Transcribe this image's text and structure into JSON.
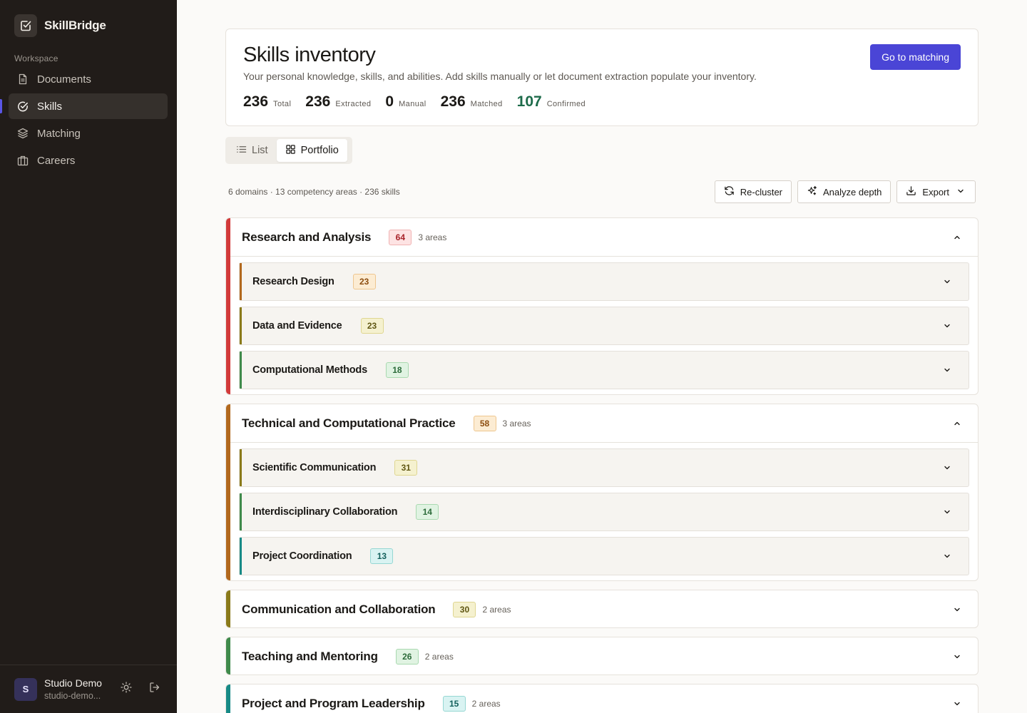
{
  "app": {
    "name": "SkillBridge"
  },
  "sidebar": {
    "section_label": "Workspace",
    "items": [
      {
        "label": "Documents",
        "icon": "document-icon",
        "active": false
      },
      {
        "label": "Skills",
        "icon": "check-circle-icon",
        "active": true
      },
      {
        "label": "Matching",
        "icon": "layers-icon",
        "active": false
      },
      {
        "label": "Careers",
        "icon": "briefcase-icon",
        "active": false
      }
    ],
    "user": {
      "initial": "S",
      "name": "Studio Demo",
      "email": "studio-demo..."
    }
  },
  "header": {
    "title": "Skills inventory",
    "subtitle": "Your personal knowledge, skills, and abilities. Add skills manually or let document extraction populate your inventory.",
    "primary_button": "Go to matching",
    "stats": [
      {
        "value": "236",
        "label": "Total"
      },
      {
        "value": "236",
        "label": "Extracted"
      },
      {
        "value": "0",
        "label": "Manual"
      },
      {
        "value": "236",
        "label": "Matched"
      },
      {
        "value": "107",
        "label": "Confirmed",
        "color": "#1d6b4a"
      }
    ]
  },
  "view_toggle": {
    "list": "List",
    "portfolio": "Portfolio",
    "active": "Portfolio"
  },
  "summary": "6 domains · 13 competency areas · 236 skills",
  "toolbar": {
    "recluster": "Re-cluster",
    "analyze": "Analyze depth",
    "export": "Export"
  },
  "colors": {
    "accent": "#4a45d6",
    "sidebar_bg": "#211c19"
  },
  "domains": [
    {
      "title": "Research and Analysis",
      "count": "64",
      "areas": "3 areas",
      "expanded": true,
      "color": "#d23a3a",
      "competencies": [
        {
          "title": "Research Design",
          "count": "23",
          "color": "#b2681d"
        },
        {
          "title": "Data and Evidence",
          "count": "23",
          "color": "#8a7a1a"
        },
        {
          "title": "Computational Methods",
          "count": "18",
          "color": "#3f8a4b"
        }
      ]
    },
    {
      "title": "Technical and Computational Practice",
      "count": "58",
      "areas": "3 areas",
      "expanded": true,
      "color": "#b2681d",
      "competencies": [
        {
          "title": "Scientific Communication",
          "count": "31",
          "color": "#8a7a1a"
        },
        {
          "title": "Interdisciplinary Collaboration",
          "count": "14",
          "color": "#3f8a4b"
        },
        {
          "title": "Project Coordination",
          "count": "13",
          "color": "#178a86"
        }
      ]
    },
    {
      "title": "Communication and Collaboration",
      "count": "30",
      "areas": "2 areas",
      "expanded": false,
      "color": "#8a7a1a"
    },
    {
      "title": "Teaching and Mentoring",
      "count": "26",
      "areas": "2 areas",
      "expanded": false,
      "color": "#3f8a4b"
    },
    {
      "title": "Project and Program Leadership",
      "count": "15",
      "areas": "2 areas",
      "expanded": false,
      "color": "#178a86"
    }
  ]
}
